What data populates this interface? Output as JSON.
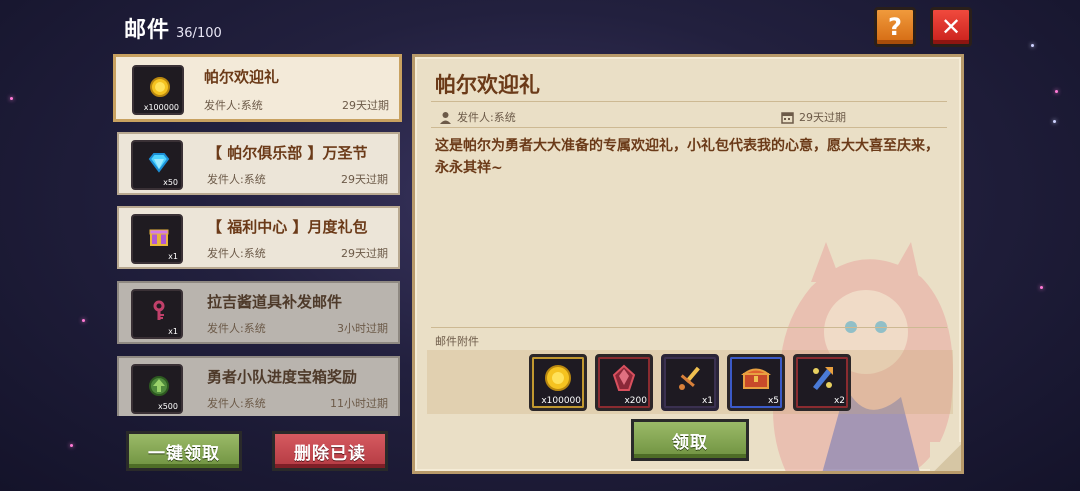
{
  "header": {
    "title": "邮件",
    "count": "36/100"
  },
  "top_buttons": {
    "help_label": "?",
    "close_label": "✕"
  },
  "mails": [
    {
      "title": "帕尔欢迎礼",
      "sender": "发件人:系统",
      "expire": "29天过期",
      "icon": "gold-coin-icon",
      "qty": "x100000"
    },
    {
      "title": "【 帕尔俱乐部 】万圣节",
      "sender": "发件人:系统",
      "expire": "29天过期",
      "icon": "diamond-icon",
      "qty": "x50"
    },
    {
      "title": "【 福利中心 】月度礼包",
      "sender": "发件人:系统",
      "expire": "29天过期",
      "icon": "gift-box-icon",
      "qty": "x1"
    },
    {
      "title": "拉吉酱道具补发邮件",
      "sender": "发件人:系统",
      "expire": "3小时过期",
      "icon": "key-icon",
      "qty": "x1"
    },
    {
      "title": "勇者小队进度宝箱奖励",
      "sender": "发件人:系统",
      "expire": "11小时过期",
      "icon": "level-up-icon",
      "qty": "x500"
    }
  ],
  "bottom_buttons": {
    "claim_all": "一键领取",
    "delete_read": "删除已读"
  },
  "detail": {
    "title": "帕尔欢迎礼",
    "sender": "发件人:系统",
    "expire": "29天过期",
    "body": "这是帕尔为勇者大大准备的专属欢迎礼，小礼包代表我的心意，愿大大喜至庆来，永永其祥~",
    "attachments_label": "邮件附件",
    "attachments": [
      {
        "icon": "gold-coin-icon",
        "qty": "x100000"
      },
      {
        "icon": "red-crystal-icon",
        "qty": "x200"
      },
      {
        "icon": "golden-sword-icon",
        "qty": "x1"
      },
      {
        "icon": "treasure-chest-icon",
        "qty": "x5"
      },
      {
        "icon": "skill-scroll-icon",
        "qty": "x2"
      }
    ],
    "claim_label": "领取"
  }
}
